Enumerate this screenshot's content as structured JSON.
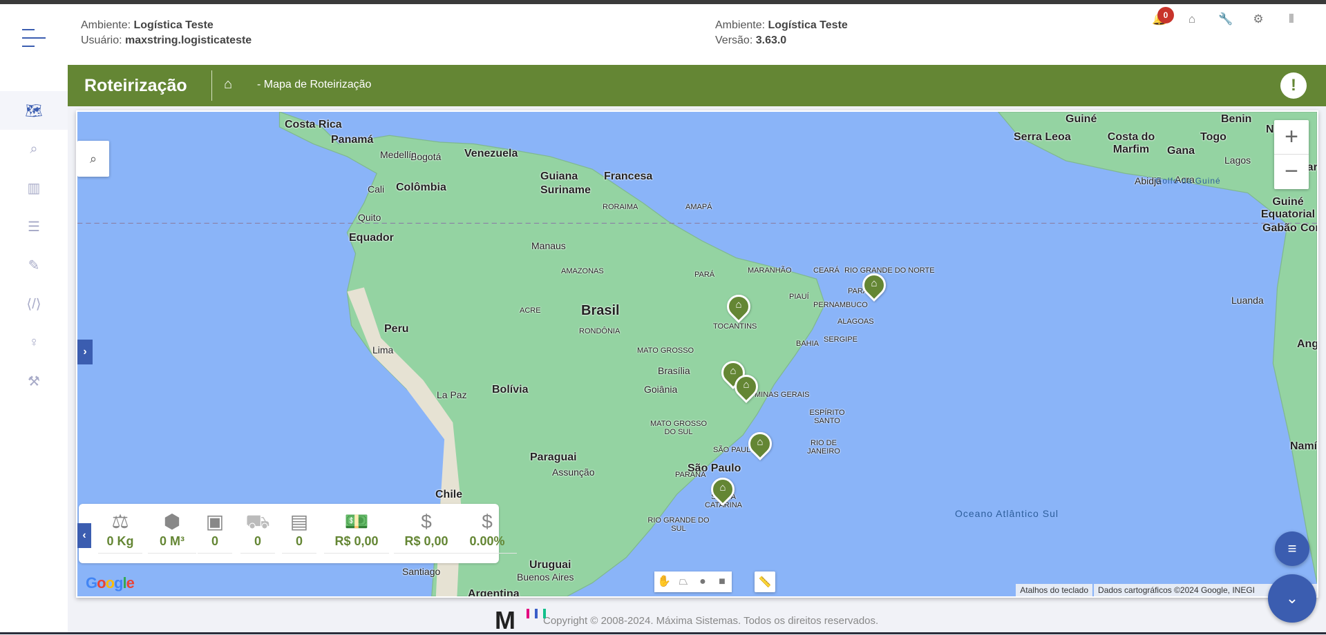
{
  "header": {
    "env_label": "Ambiente:",
    "env_value": "Logística Teste",
    "user_label": "Usuário:",
    "user_value": "maxstring.logisticateste",
    "env2_label": "Ambiente:",
    "env2_value": "Logística Teste",
    "version_label": "Versão:",
    "version_value": "3.63.0",
    "notifications_count": "0",
    "icons": [
      "bell-icon",
      "home-icon",
      "wrench-icon",
      "gear-icon",
      "logout-icon"
    ]
  },
  "sidebar": {
    "items": [
      "map",
      "search",
      "chart",
      "filters",
      "edit",
      "code-file",
      "pin",
      "magic-wand"
    ],
    "active": "map"
  },
  "page": {
    "title": "Roteirização",
    "breadcrumb": "- Mapa de Roteirização",
    "alert": "!"
  },
  "map": {
    "labels": {
      "brasil": "Brasil",
      "peru": "Peru",
      "bolivia": "Bolívia",
      "colombia": "Colômbia",
      "venezuela": "Venezuela",
      "equador": "Equador",
      "paraguai": "Paraguai",
      "chile": "Chile",
      "uruguai": "Uruguai",
      "argentina": "Argentina",
      "suriname": "Suriname",
      "guiana": "Guiana",
      "guiana_francesa": "Francesa",
      "costa_rica": "Costa Rica",
      "panama": "Panamá",
      "manaus": "Manaus",
      "brasilia": "Brasília",
      "goiania": "Goiânia",
      "sao_paulo": "São Paulo",
      "lima": "Lima",
      "la_paz": "La Paz",
      "quito": "Quito",
      "bogota": "Bogotá",
      "medellin": "Medellín",
      "cali": "Cali",
      "assuncao": "Assunção",
      "santiago": "Santiago",
      "buenos_aires": "Buenos Aires",
      "luanda": "Luanda",
      "lagos": "Lagos",
      "abidja": "Abidjã",
      "acra": "Acra",
      "amazonas": "AMAZONAS",
      "para": "PARÁ",
      "maranhao": "MARANHÃO",
      "piaui": "PIAUÍ",
      "ceara": "CEARÁ",
      "rn": "RIO GRANDE DO NORTE",
      "pernambuco": "PERNAMBUCO",
      "paraiba": "PARAÍBA",
      "alagoas": "ALAGOAS",
      "sergipe": "SERGIPE",
      "bahia": "BAHIA",
      "tocantins": "TOCANTINS",
      "mato_grosso": "MATO GROSSO",
      "rondonia": "RONDÔNIA",
      "acre": "ACRE",
      "roraima": "RORAIMA",
      "amapa": "AMAPÁ",
      "minas": "MINAS GERAIS",
      "es": "ESPÍRITO SANTO",
      "rj": "RIO DE JANEIRO",
      "ms": "MATO GROSSO DO SUL",
      "sp": "SÃO PAULO",
      "parana": "PARANÁ",
      "sc": "SANTA CATARINA",
      "rs": "RIO GRANDE DO SUL",
      "guine": "Guiné",
      "serra_leoa": "Serra Leoa",
      "costa_marfim": "Costa do Marfim",
      "gana": "Gana",
      "togo": "Togo",
      "benim": "Benin",
      "nigeria": "Nigéria",
      "camaroes": "Camar",
      "guine_eq": "Guiné Equatorial",
      "gabao": "Gabão",
      "congo": "Congo",
      "angola": "Ang",
      "namibia": "Namí",
      "golfo": "Golfo da Guiné",
      "oceano": "Oceano Atlântico Sul"
    },
    "zoom_in": "+",
    "zoom_out": "−",
    "google": "Google",
    "attribution": [
      "Atalhos do teclado",
      "Dados cartográficos ©2024 Google, INEGI"
    ],
    "markers": 6,
    "colors": {
      "ocean": "#8ab4f8",
      "land": "#8fd1a0",
      "accent": "#648634",
      "primary": "#3b5db0"
    }
  },
  "stats": [
    {
      "icon": "weight-icon",
      "value": "0 Kg"
    },
    {
      "icon": "cubes-icon",
      "value": "0 M³"
    },
    {
      "icon": "box-icon",
      "value": "0"
    },
    {
      "icon": "truck-icon",
      "value": "0"
    },
    {
      "icon": "boxes-icon",
      "value": "0"
    },
    {
      "icon": "money-icon",
      "value": "R$ 0,00"
    },
    {
      "icon": "dollar-coin-icon",
      "value": "R$ 0,00"
    },
    {
      "icon": "dollar-coin-icon",
      "value": "0.00%"
    }
  ],
  "footer": {
    "logo": "M",
    "copyright": "Copyright © 2008-2024. Máxima Sistemas. Todos os direitos reservados."
  }
}
